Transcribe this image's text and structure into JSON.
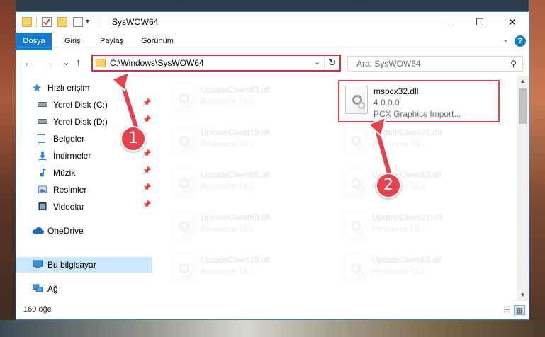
{
  "window": {
    "title": "SysWOW64",
    "minimize": "—",
    "maximize": "☐",
    "close": "✕"
  },
  "ribbon": {
    "tabs": [
      "Dosya",
      "Giriş",
      "Paylaş",
      "Görünüm"
    ],
    "help": "?",
    "expand": "⌄"
  },
  "navbar": {
    "back": "←",
    "forward": "→",
    "recent": "⌄",
    "up": "↑",
    "address": "C:\\Windows\\SysWOW64",
    "address_dropdown": "⌄",
    "refresh": "↻",
    "search_placeholder": "Ara: SysWOW64",
    "search_icon": "⚲"
  },
  "sidebar": {
    "items": [
      {
        "label": "Hızlı erişim",
        "icon": "star-icon"
      },
      {
        "label": "Yerel Disk (C:)",
        "icon": "drive-icon"
      },
      {
        "label": "Yerel Disk (D:)",
        "icon": "drive-icon"
      },
      {
        "label": "Belgeler",
        "icon": "documents-icon"
      },
      {
        "label": "İndirmeler",
        "icon": "download-icon"
      },
      {
        "label": "Müzik",
        "icon": "music-icon"
      },
      {
        "label": "Resimler",
        "icon": "pictures-icon"
      },
      {
        "label": "Videolar",
        "icon": "video-icon"
      },
      {
        "label": "OneDrive",
        "icon": "cloud-icon"
      },
      {
        "label": "Bu bilgisayar",
        "icon": "computer-icon"
      },
      {
        "label": "Ağ",
        "icon": "network-icon"
      }
    ],
    "pin": "📌"
  },
  "files": [
    {
      "name": "UpdateClient63.dll",
      "type": "Resource DLL"
    },
    {
      "name": "mspcx32.dll",
      "version": "4.0.0.0",
      "description": "PCX Graphics Import..."
    },
    {
      "name": "UpdateClient19.dll",
      "type": "Resource DLL"
    },
    {
      "name": "UpdateClient21.dll",
      "type": "Resource DLL"
    },
    {
      "name": "UpdateClient65.dll",
      "type": "Resource DLL"
    },
    {
      "name": "UpdateClient63.dll",
      "type": "Resource DLL"
    },
    {
      "name": "UpdateClient63.dll",
      "type": "Resource DLL"
    },
    {
      "name": "UpdateClient21.dll",
      "type": "Resource DLL"
    },
    {
      "name": "UpdateClient19.dll",
      "type": "Resource DLL"
    },
    {
      "name": "UpdateClient65.dll",
      "type": "Resource DLL"
    }
  ],
  "status": {
    "count": "160 öğe"
  },
  "callouts": {
    "one": "1",
    "two": "2"
  },
  "colors": {
    "accent": "#1979ca",
    "highlight_red": "#e0424f",
    "selected_bg": "#cce8ff"
  }
}
